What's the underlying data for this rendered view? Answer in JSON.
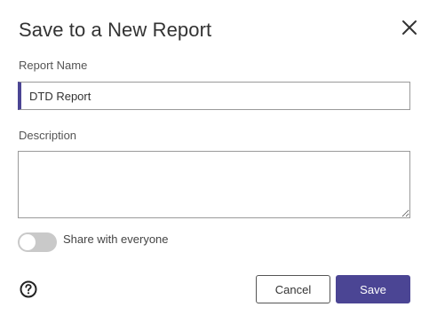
{
  "dialog": {
    "title": "Save to a New Report",
    "close_icon": "close-icon"
  },
  "report_name": {
    "label": "Report Name",
    "value": "DTD Report"
  },
  "description": {
    "label": "Description",
    "value": ""
  },
  "share": {
    "label": "Share with everyone",
    "enabled": false
  },
  "footer": {
    "help_icon": "help-icon",
    "cancel_label": "Cancel",
    "save_label": "Save"
  },
  "colors": {
    "accent": "#4b4594",
    "toggle_off": "#c9c9c9",
    "text": "#333333"
  }
}
